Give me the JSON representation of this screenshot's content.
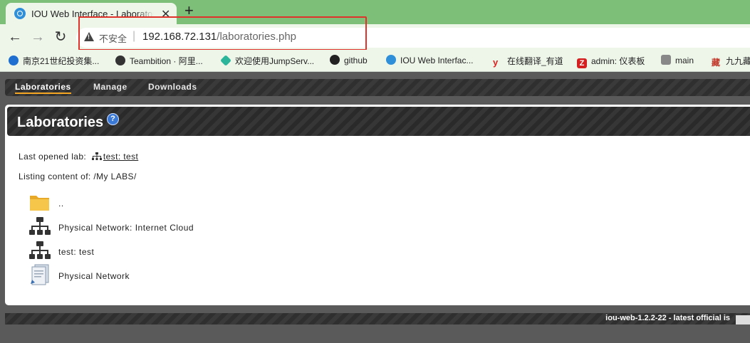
{
  "browser": {
    "tab_title": "IOU Web Interface - Laboratories",
    "tab_close": "✕",
    "new_tab": "+",
    "insecure_label": "不安全",
    "url_host": "192.168.72.131",
    "url_path": "/laboratories.php",
    "bookmarks": [
      {
        "label": "南京21世纪投资集...",
        "icon_color": "#1e6fd0"
      },
      {
        "label": "Teambition · 阿里...",
        "icon_color": "#333333"
      },
      {
        "label": "欢迎使用JumpServ...",
        "icon_color": "#2bb59a"
      },
      {
        "label": "github",
        "icon_color": "#222222"
      },
      {
        "label": "IOU Web Interfac...",
        "icon_color": "#2f8fd8"
      },
      {
        "label": "在线翻译_有道",
        "icon_color": "#e02020"
      },
      {
        "label": "admin: 仪表板",
        "icon_color": "#d42020"
      },
      {
        "label": "main",
        "icon_color": "#555555"
      },
      {
        "label": "九九藏",
        "icon_color": "#c0392b"
      }
    ]
  },
  "nav": {
    "items": [
      "Laboratories",
      "Manage",
      "Downloads"
    ]
  },
  "panel": {
    "title": "Laboratories",
    "help": "?",
    "last_opened_prefix": "Last opened lab:",
    "last_opened_lab": "test: test",
    "listing_prefix": "Listing content of:",
    "listing_path": "/My LABS/",
    "items": [
      {
        "label": "..",
        "icon": "folder-icon"
      },
      {
        "label": "Physical Network: Internet Cloud",
        "icon": "network-icon"
      },
      {
        "label": "test: test",
        "icon": "network-icon"
      },
      {
        "label": "Physical Network",
        "icon": "document-icon"
      }
    ]
  },
  "footer": {
    "text": "iou-web-1.2.2-22 - latest official is"
  }
}
